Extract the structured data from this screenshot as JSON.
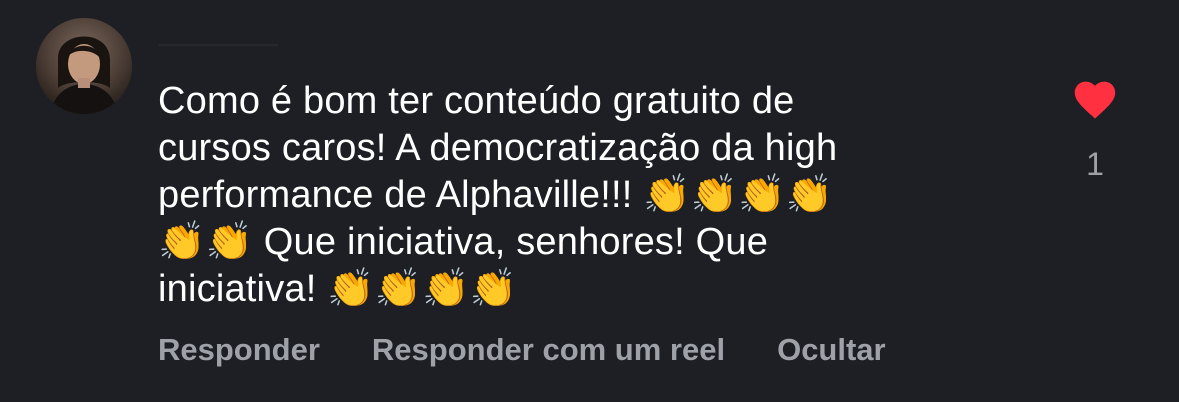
{
  "comment": {
    "text": "Como é bom ter conteúdo gratuito de\ncursos caros! A democratização da high\nperformance de Alphaville!!! 👏👏👏👏\n👏👏 Que iniciativa, senhores! Que\niniciativa! 👏👏👏👏",
    "like_count": "1",
    "liked": true,
    "like_color": "#ff3040"
  },
  "actions": {
    "reply": "Responder",
    "reply_reel": "Responder com um reel",
    "hide": "Ocultar"
  },
  "icons": {
    "like": "heart-icon",
    "avatar": "user-avatar"
  }
}
